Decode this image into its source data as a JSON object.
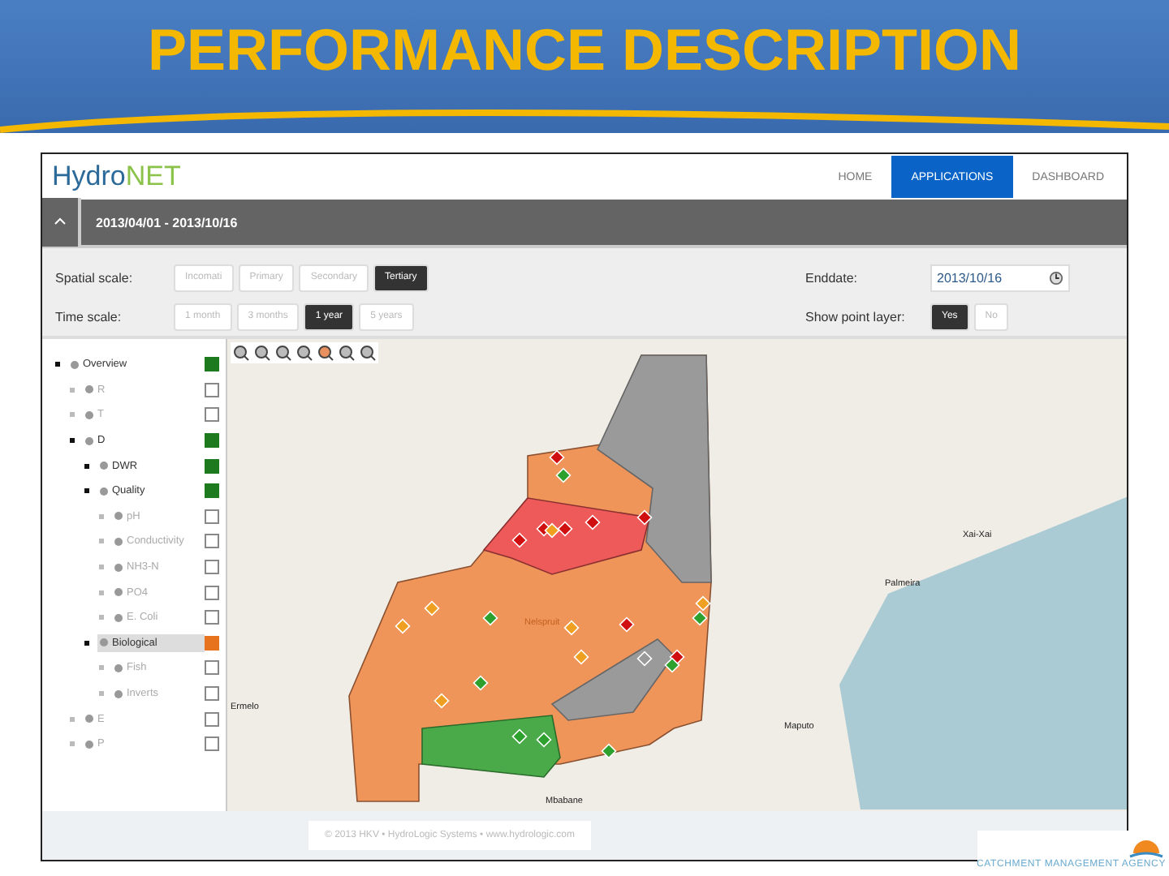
{
  "slide": {
    "title": "PERFORMANCE DESCRIPTION",
    "logo_text": "CATCHMENT MANAGEMENT AGENCY"
  },
  "app": {
    "logo": {
      "part1": "Hydro",
      "part2": "NET"
    },
    "nav": [
      {
        "label": "HOME",
        "selected": false
      },
      {
        "label": "APPLICATIONS",
        "selected": true
      },
      {
        "label": "DASHBOARD",
        "selected": false
      }
    ],
    "period": "2013/04/01 - 2013/10/16",
    "controls": [
      {
        "label": "Spatial scale:",
        "options": [
          {
            "label": "Incomati",
            "selected": false
          },
          {
            "label": "Primary",
            "selected": false
          },
          {
            "label": "Secondary",
            "selected": false
          },
          {
            "label": "Tertiary",
            "selected": true
          }
        ]
      },
      {
        "label": "Time scale:",
        "options": [
          {
            "label": "1 month",
            "selected": false
          },
          {
            "label": "3 months",
            "selected": false
          },
          {
            "label": "1 year",
            "selected": true
          },
          {
            "label": "5 years",
            "selected": false
          }
        ]
      }
    ],
    "enddate": {
      "label": "Enddate:",
      "value": "2013/10/16"
    },
    "point_layer": {
      "label": "Show point layer:",
      "options": [
        {
          "label": "Yes",
          "selected": true
        },
        {
          "label": "No",
          "selected": false
        }
      ]
    },
    "tree": [
      {
        "label": "Overview",
        "active": true,
        "checked": true,
        "color": "#1e7a1e",
        "selected": false,
        "children": [
          {
            "label": "R",
            "active": false,
            "checked": false,
            "selected": false
          },
          {
            "label": "T",
            "active": false,
            "checked": false,
            "selected": false
          },
          {
            "label": "D",
            "active": true,
            "checked": true,
            "color": "#1e7a1e",
            "selected": false,
            "children": [
              {
                "label": "DWR",
                "active": true,
                "checked": true,
                "color": "#1e7a1e",
                "selected": false
              },
              {
                "label": "Quality",
                "active": true,
                "checked": true,
                "color": "#1e7a1e",
                "selected": false,
                "children": [
                  {
                    "label": "pH",
                    "active": false,
                    "checked": false,
                    "selected": false
                  },
                  {
                    "label": "Conductivity",
                    "active": false,
                    "checked": false,
                    "selected": false
                  },
                  {
                    "label": "NH3-N",
                    "active": false,
                    "checked": false,
                    "selected": false
                  },
                  {
                    "label": "PO4",
                    "active": false,
                    "checked": false,
                    "selected": false
                  },
                  {
                    "label": "E. Coli",
                    "active": false,
                    "checked": false,
                    "selected": false
                  }
                ]
              },
              {
                "label": "Biological",
                "active": true,
                "checked": true,
                "color": "#e8731e",
                "selected": true,
                "children": [
                  {
                    "label": "Fish",
                    "active": false,
                    "checked": false,
                    "selected": false
                  },
                  {
                    "label": "Inverts",
                    "active": false,
                    "checked": false,
                    "selected": false
                  }
                ]
              }
            ]
          },
          {
            "label": "E",
            "active": false,
            "checked": false,
            "selected": false
          },
          {
            "label": "P",
            "active": false,
            "checked": false,
            "selected": false
          }
        ]
      }
    ],
    "map_labels": [
      {
        "text": "Ermelo",
        "kind": "town"
      },
      {
        "text": "Nelspruit",
        "kind": "capital"
      },
      {
        "text": "Mbabane",
        "kind": "town"
      },
      {
        "text": "Maputo",
        "kind": "town"
      },
      {
        "text": "Palmeira",
        "kind": "town"
      },
      {
        "text": "Xai-Xai",
        "kind": "town"
      }
    ],
    "footer": "© 2013 HKV • HydroLogic Systems • www.hydrologic.com"
  }
}
